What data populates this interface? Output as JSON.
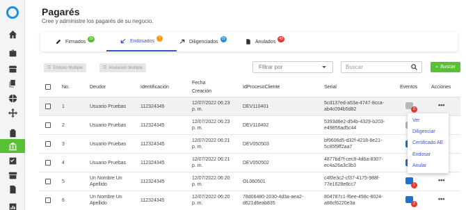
{
  "page": {
    "title": "Pagarés",
    "subtitle": "Cree y administre los pagarés de su negocio."
  },
  "tabs": [
    {
      "label": "Firmados",
      "count": "15",
      "badge_color": "#58c133"
    },
    {
      "label": "Endosados",
      "count": "7",
      "badge_color": "#f39c12"
    },
    {
      "label": "Diligenciados",
      "count": "25",
      "badge_color": "#1d8fe0"
    },
    {
      "label": "Anulados",
      "count": "43",
      "badge_color": "#e53935"
    }
  ],
  "toolbar": {
    "endoso_multiple": "Endoso Multiple",
    "anulacion_multiple": "Anulación Multiple",
    "filter_placeholder": "Filtrar por",
    "search_placeholder": "Buscar",
    "search_button": "Buscar"
  },
  "table": {
    "headers": {
      "no": "No.",
      "deudor": "Deudor",
      "identificacion": "Identificación",
      "fecha_line1": "Fecha",
      "fecha_line2": "Creación",
      "id_proceso": "IdProcesoCliente",
      "serial": "Serial",
      "eventos": "Eventos",
      "acciones": "Acciones"
    },
    "rows": [
      {
        "no": "1",
        "deudor1": "Usuario Pruebas",
        "deudor2": "",
        "id": "112324345",
        "fecha1": "12/07/2022 06:23",
        "fecha2": "p. m.",
        "proceso1": "DEV110401",
        "proceso2": "",
        "serial1": "5cd137ed-a53a-4747-8cca-",
        "serial2": "ab4c094b5d82",
        "event_badge": "0"
      },
      {
        "no": "2",
        "deudor1": "Usuario Pruebas",
        "deudor2": "",
        "id": "112324345",
        "fecha1": "12/07/2022 06:23",
        "fecha2": "p. m.",
        "proceso1": "DEV110402",
        "proceso2": "",
        "serial1": "5393d6e2-d54b-4329-b203-",
        "serial2": "e49856ad5c44",
        "event_badge": ""
      },
      {
        "no": "3",
        "deudor1": "Usuario Pruebas",
        "deudor2": "",
        "id": "112324345",
        "fecha1": "12/07/2022 06:21",
        "fecha2": "p. m.",
        "proceso1": "DEV050503",
        "proceso2": "",
        "serial1": "bf9606d5-d32f-4218-8e21-",
        "serial2": "5c85f9ff2aa7",
        "event_badge": ""
      },
      {
        "no": "4",
        "deudor1": "Usuario Pruebas",
        "deudor2": "",
        "id": "112324345",
        "fecha1": "12/07/2022 06:21",
        "fecha2": "p. m.",
        "proceso1": "DEV050502",
        "proceso2": "",
        "serial1": "4877bd7f-cec8-4d6a-8307-",
        "serial2": "ec4a26a3c3b3",
        "event_badge": ""
      },
      {
        "no": "5",
        "deudor1": "Un Nombre Un",
        "deudor2": "Apellido",
        "id": "112324345",
        "fecha1": "12/07/2022 06:20",
        "fecha2": "p. m.",
        "proceso1": "OL060501",
        "proceso2": "",
        "serial1": "c4f0e3c2-cf37-4175-988f-",
        "serial2": "77e1628e8cc7",
        "event_badge": "1"
      },
      {
        "no": "6",
        "deudor1": "Un Nombre Un",
        "deudor2": "Apellido",
        "id": "112324345",
        "fecha1": "12/07/2022 06:20",
        "fecha2": "p. m.",
        "proceso1": "78d06480-2030-4d3a-aea2-",
        "proceso2": "d621d6eab835",
        "serial1": "804787c1-f6ee-498c-8024-",
        "serial2": "a88cf6220e3a",
        "event_badge": "2"
      }
    ]
  },
  "menu": {
    "items": [
      "Ver",
      "Diligenciar",
      "Certificado AE",
      "Endosar",
      "Anular"
    ]
  },
  "colors": {
    "accent_green": "#58c133",
    "brand_blue": "#1d8fe0",
    "menu_blue": "#3b56c9",
    "event_gray": "#b9b9b9",
    "event_blue": "#1d6fd6"
  }
}
